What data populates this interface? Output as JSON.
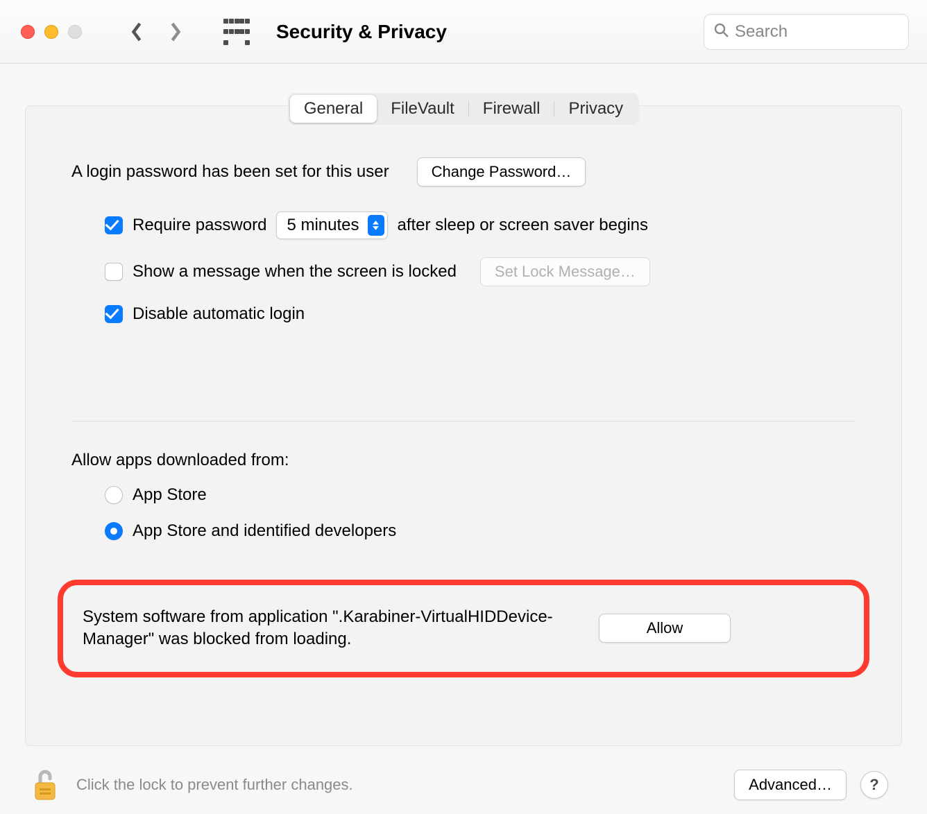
{
  "window": {
    "title": "Security & Privacy"
  },
  "search": {
    "placeholder": "Search"
  },
  "tabs": {
    "general": "General",
    "filevault": "FileVault",
    "firewall": "Firewall",
    "privacy": "Privacy"
  },
  "login": {
    "status_text": "A login password has been set for this user",
    "change_password_label": "Change Password…",
    "require_password_prefix": "Require password",
    "require_password_value": "5 minutes",
    "require_password_suffix": "after sleep or screen saver begins",
    "show_message_label": "Show a message when the screen is locked",
    "set_lock_message_label": "Set Lock Message…",
    "disable_auto_login_label": "Disable automatic login"
  },
  "gatekeeper": {
    "heading": "Allow apps downloaded from:",
    "option_app_store": "App Store",
    "option_identified": "App Store and identified developers"
  },
  "blocked": {
    "message": "System software from application \".Karabiner-VirtualHIDDevice-Manager\" was blocked from loading.",
    "allow_label": "Allow"
  },
  "footer": {
    "lock_text": "Click the lock to prevent further changes.",
    "advanced_label": "Advanced…",
    "help_label": "?"
  }
}
